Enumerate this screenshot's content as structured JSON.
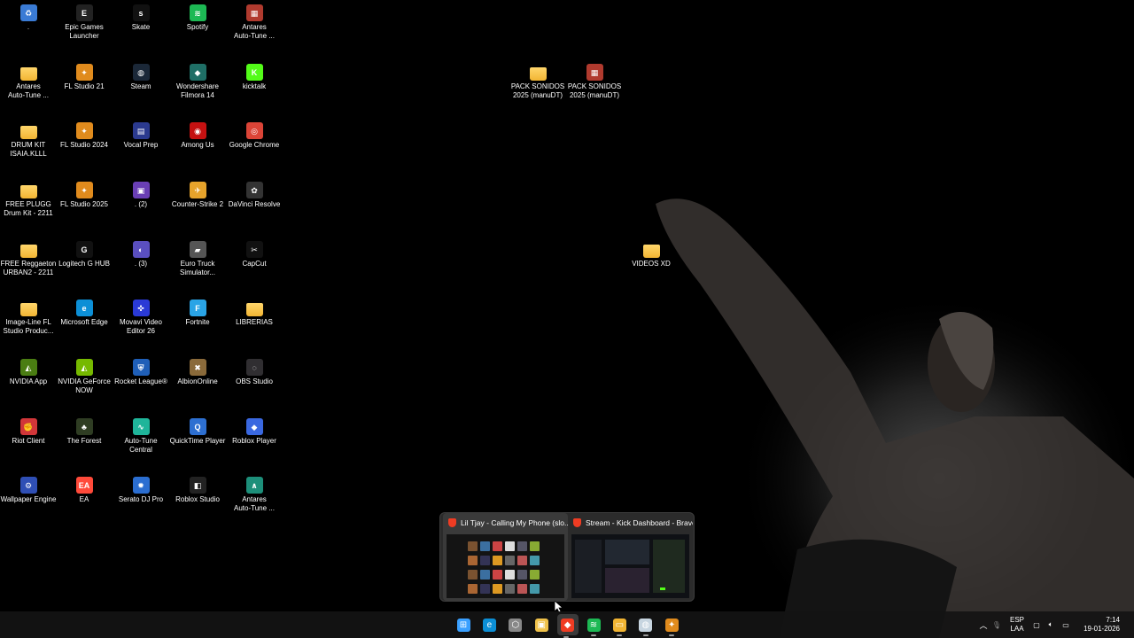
{
  "desktop": {
    "icons": [
      {
        "label": ".",
        "color": "#3a7bd5",
        "glyph": "♻",
        "kind": "app"
      },
      {
        "label": "Epic Games\nLauncher",
        "color": "#222",
        "glyph": "E",
        "kind": "app"
      },
      {
        "label": "Skate",
        "color": "#111",
        "glyph": "s",
        "kind": "app"
      },
      {
        "label": "Spotify",
        "color": "#1db954",
        "glyph": "≋",
        "kind": "app"
      },
      {
        "label": "Antares\nAuto-Tune ...",
        "color": "#b03a2e",
        "glyph": "▦",
        "kind": "app"
      },
      {
        "label": "Antares\nAuto-Tune ...",
        "color": "",
        "glyph": "",
        "kind": "folder"
      },
      {
        "label": "FL Studio 21",
        "color": "#e08b1d",
        "glyph": "✦",
        "kind": "app"
      },
      {
        "label": "Steam",
        "color": "#1b2838",
        "glyph": "◍",
        "kind": "app"
      },
      {
        "label": "Wondershare\nFilmora 14",
        "color": "#1f6f66",
        "glyph": "◆",
        "kind": "app"
      },
      {
        "label": "kicktalk",
        "color": "#53fc18",
        "glyph": "K",
        "kind": "app"
      },
      {
        "label": "DRUM KIT\nISAIA.KLLL",
        "color": "",
        "glyph": "",
        "kind": "folder"
      },
      {
        "label": "FL Studio 2024",
        "color": "#e08b1d",
        "glyph": "✦",
        "kind": "app"
      },
      {
        "label": "Vocal Prep",
        "color": "#2b3a8f",
        "glyph": "▤",
        "kind": "app"
      },
      {
        "label": "Among Us",
        "color": "#c51111",
        "glyph": "◉",
        "kind": "app"
      },
      {
        "label": "Google Chrome",
        "color": "#db4437",
        "glyph": "◎",
        "kind": "app"
      },
      {
        "label": "FREE PLUGG\nDrum Kit - 2211",
        "color": "",
        "glyph": "",
        "kind": "folder"
      },
      {
        "label": "FL Studio 2025",
        "color": "#e08b1d",
        "glyph": "✦",
        "kind": "app"
      },
      {
        "label": ". (2)",
        "color": "#6a3fb5",
        "glyph": "▣",
        "kind": "app"
      },
      {
        "label": "Counter-Strike 2",
        "color": "#e6a32b",
        "glyph": "✈",
        "kind": "app"
      },
      {
        "label": "DaVinci Resolve",
        "color": "#333",
        "glyph": "✿",
        "kind": "app"
      },
      {
        "label": "FREE Reggaeton\nURBAN2 - 2211",
        "color": "",
        "glyph": "",
        "kind": "folder"
      },
      {
        "label": "Logitech G HUB",
        "color": "#111",
        "glyph": "G",
        "kind": "app"
      },
      {
        "label": ". (3)",
        "color": "#5a4fbf",
        "glyph": "◐",
        "kind": "app"
      },
      {
        "label": "Euro Truck\nSimulator...",
        "color": "#555",
        "glyph": "▰",
        "kind": "app"
      },
      {
        "label": "CapCut",
        "color": "#111",
        "glyph": "✂",
        "kind": "app"
      },
      {
        "label": "Image-Line FL\nStudio Produc...",
        "color": "",
        "glyph": "",
        "kind": "folder"
      },
      {
        "label": "Microsoft Edge",
        "color": "#0c8fd6",
        "glyph": "e",
        "kind": "app"
      },
      {
        "label": "Movavi Video\nEditor 26",
        "color": "#2a3ad6",
        "glyph": "✜",
        "kind": "app"
      },
      {
        "label": "Fortnite",
        "color": "#2aa4e6",
        "glyph": "F",
        "kind": "app"
      },
      {
        "label": "LIBRERIAS",
        "color": "",
        "glyph": "",
        "kind": "folder"
      },
      {
        "label": "NVIDIA App",
        "color": "#4a7d12",
        "glyph": "◭",
        "kind": "app"
      },
      {
        "label": "NVIDIA GeForce\nNOW",
        "color": "#76b900",
        "glyph": "◭",
        "kind": "app"
      },
      {
        "label": "Rocket League®",
        "color": "#1f5fb8",
        "glyph": "⛨",
        "kind": "app"
      },
      {
        "label": "AlbionOnline",
        "color": "#8a6a3a",
        "glyph": "✖",
        "kind": "app"
      },
      {
        "label": "OBS Studio",
        "color": "#302e31",
        "glyph": "◌",
        "kind": "app"
      },
      {
        "label": "Riot Client",
        "color": "#d13639",
        "glyph": "✊",
        "kind": "app"
      },
      {
        "label": "The Forest",
        "color": "#2f3d23",
        "glyph": "♣",
        "kind": "app"
      },
      {
        "label": "Auto-Tune\nCentral",
        "color": "#1fb59a",
        "glyph": "∿",
        "kind": "app"
      },
      {
        "label": "QuickTime Player",
        "color": "#2d6fd1",
        "glyph": "Q",
        "kind": "app"
      },
      {
        "label": "Roblox Player",
        "color": "#3a68e0",
        "glyph": "◆",
        "kind": "app"
      },
      {
        "label": "Wallpaper Engine",
        "color": "#2f4fb5",
        "glyph": "⚙",
        "kind": "app"
      },
      {
        "label": "EA",
        "color": "#ff4a3a",
        "glyph": "EA",
        "kind": "app"
      },
      {
        "label": "Serato DJ Pro",
        "color": "#2b6ed1",
        "glyph": "✹",
        "kind": "app"
      },
      {
        "label": "Roblox Studio",
        "color": "#222",
        "glyph": "◧",
        "kind": "app"
      },
      {
        "label": "Antares\nAuto-Tune ...",
        "color": "#1d8f7a",
        "glyph": "∧",
        "kind": "app"
      },
      {
        "label": "PACK SONIDOS\n2025 (manuDT)",
        "color": "",
        "glyph": "",
        "kind": "folder"
      },
      {
        "label": "PACK SONIDOS\n2025 (manuDT)",
        "color": "#b03a2e",
        "glyph": "▦",
        "kind": "app"
      },
      {
        "label": "VIDEOS XD",
        "color": "",
        "glyph": "",
        "kind": "folder"
      }
    ]
  },
  "thumbnails": [
    {
      "title": "Lil Tjay - Calling My Phone (slo...",
      "icon": "brave-icon"
    },
    {
      "title": "Stream - Kick Dashboard - Brave",
      "icon": "brave-icon"
    }
  ],
  "taskbar": {
    "apps": [
      {
        "name": "start",
        "color": "#3aa0ff",
        "glyph": "⊞"
      },
      {
        "name": "edge",
        "color": "#0c8fd6",
        "glyph": "e"
      },
      {
        "name": "settings",
        "color": "#888",
        "glyph": "⬡"
      },
      {
        "name": "store",
        "color": "#f0c24a",
        "glyph": "▣"
      },
      {
        "name": "brave",
        "color": "#ef3c23",
        "glyph": "◆"
      },
      {
        "name": "spotify",
        "color": "#1db954",
        "glyph": "≋"
      },
      {
        "name": "explorer",
        "color": "#f2b533",
        "glyph": "▭"
      },
      {
        "name": "steam",
        "color": "#c7d5e0",
        "glyph": "◍"
      },
      {
        "name": "fl-studio",
        "color": "#e08b1d",
        "glyph": "✦"
      }
    ],
    "tray": {
      "lang_top": "ESP",
      "lang_bottom": "LAA",
      "time": "7:14",
      "date": "19-01-2026"
    }
  }
}
